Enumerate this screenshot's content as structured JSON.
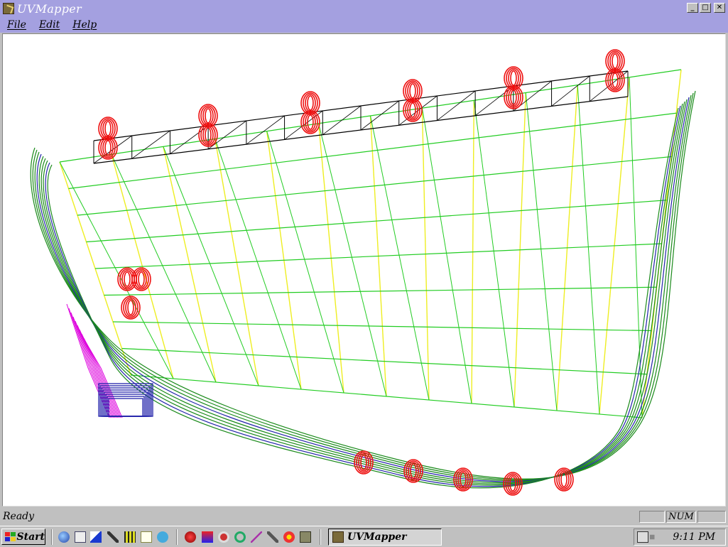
{
  "window": {
    "title": "UVMapper",
    "controls": {
      "minimize": "_",
      "maximize": "□",
      "close": "✕"
    }
  },
  "menu": [
    {
      "label": "File"
    },
    {
      "label": "Edit"
    },
    {
      "label": "Help"
    }
  ],
  "viewport": {
    "content": "3D wireframe model",
    "colors": {
      "hull": "#1a8a1a",
      "deck_green": "#22cc22",
      "deck_yellow": "#eeee22",
      "beam": "#000000",
      "lamps": "#ee1111",
      "magenta": "#dd00dd",
      "blue": "#2222aa"
    }
  },
  "status": {
    "text": "Ready",
    "panel_num": "NUM"
  },
  "taskbar": {
    "start_label": "Start",
    "quick_launch_icons": [
      "ie-icon",
      "outlook-icon",
      "arrow-icon",
      "tool-icon",
      "grid-icon",
      "note-icon",
      "paint-icon"
    ],
    "app_icons": [
      "red-orb-icon",
      "heart-icon",
      "gear-icon",
      "refresh-icon",
      "pen-icon",
      "run-icon",
      "flower-icon",
      "box-icon"
    ],
    "active_task": "UVMapper",
    "clock": "9:11 PM"
  }
}
